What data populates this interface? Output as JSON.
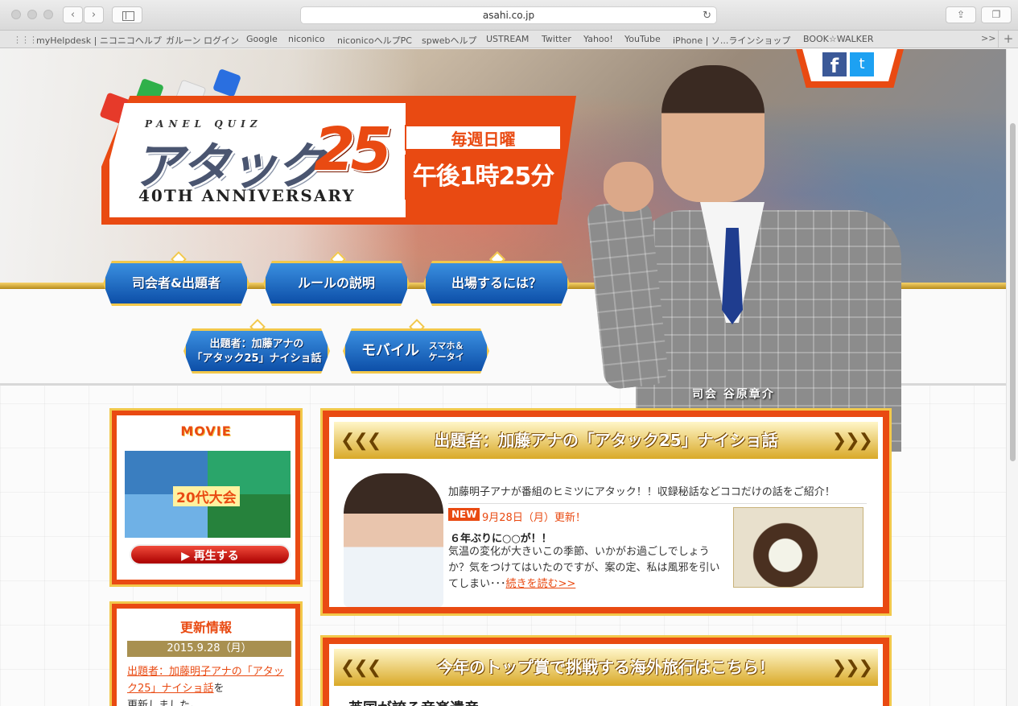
{
  "browser": {
    "url": "asahi.co.jp",
    "bookmarks": [
      "myHelpdesk | ニコニコヘルプ",
      "ガルーン ログイン",
      "Google",
      "niconico",
      "niconicoヘルプPC",
      "spwebヘルプ",
      "USTREAM",
      "Twitter",
      "Yahoo!",
      "YouTube",
      "iPhone | ソ...ラインショップ",
      "BOOK☆WALKER"
    ],
    "more": ">>",
    "plus": "+"
  },
  "header": {
    "small_title": "PANEL QUIZ",
    "main_title": "アタック",
    "number": "25",
    "anniversary": "40TH ANNIVERSARY",
    "day": "毎週日曜",
    "time": "午後1時25分",
    "facebook": "f",
    "twitter": "t"
  },
  "nav": {
    "host": "司会者&出題者",
    "rules": "ルールの説明",
    "join": "出場するには？",
    "anna_line1": "出題者：加藤アナの",
    "anna_line2": "「アタック25」ナイショ話",
    "mobile": "モバイル",
    "mobile_sub1": "スマホ＆",
    "mobile_sub2": "ケータイ"
  },
  "host_caption": "司会 谷原章介",
  "movie": {
    "title": "MOVIE",
    "band": "20代大会",
    "play": "▶ 再生する"
  },
  "news": {
    "title": "更新情報",
    "date": "2015.9.28（月）",
    "link": "出題者：加藤明子アナの「アタック25」ナイショ話",
    "after": "を",
    "after2": "更新しました。"
  },
  "feature": {
    "title": "出題者：加藤アナの「アタック25」ナイショ話",
    "intro": "加藤明子アナが番組のヒミツにアタック！！収録秘話などココだけの話をご紹介！",
    "badge": "NEW",
    "date": "9月28日（月）更新！",
    "heading": "６年ぶりに○○が！！",
    "body": "気温の変化が大きいこの季節、いかがお過ごしでしょうか？気をつけてはいたのですが、案の定、私は風邪を引いてしまい･･･",
    "more": "続きを読む>>"
  },
  "feature2": {
    "title": "今年のトップ賞で挑戦する海外旅行はこちら！",
    "sub": "英国が誇る音楽遺産"
  },
  "colors": {
    "accent": "#e94a12",
    "gold": "#f2c84b",
    "nav_blue": "#1a5fb4"
  }
}
